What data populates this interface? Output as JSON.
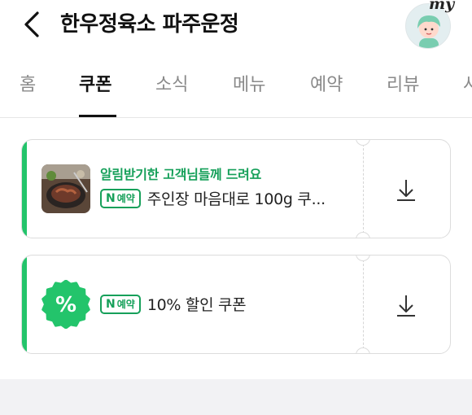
{
  "header": {
    "title": "한우정육소 파주운정",
    "back_icon": "chevron-left-icon",
    "avatar_badge": "my"
  },
  "tabs": [
    {
      "label": "홈",
      "active": false
    },
    {
      "label": "쿠폰",
      "active": true
    },
    {
      "label": "소식",
      "active": false
    },
    {
      "label": "메뉴",
      "active": false
    },
    {
      "label": "예약",
      "active": false
    },
    {
      "label": "리뷰",
      "active": false
    },
    {
      "label": "사",
      "active": false
    }
  ],
  "coupons": [
    {
      "promo_text": "알림받기한 고객님들께 드려요",
      "badge_n": "N",
      "badge_label": "예약",
      "name": "주인장 마음대로 100g 쿠...",
      "download_icon": "download-icon"
    },
    {
      "badge_n": "N",
      "badge_label": "예약",
      "name": "10% 할인 쿠폰",
      "seal_icon": "percent-icon",
      "download_icon": "download-icon"
    }
  ],
  "colors": {
    "accent_green": "#23c46b",
    "badge_green": "#16a05a",
    "tab_inactive": "#8a8a8a"
  }
}
